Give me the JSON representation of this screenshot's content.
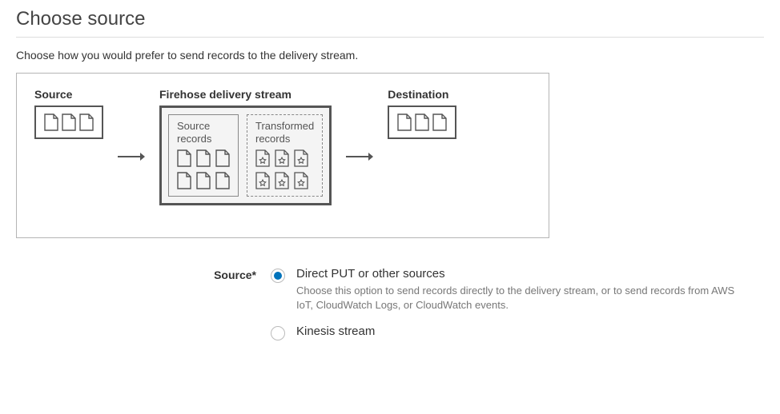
{
  "header": {
    "title": "Choose source"
  },
  "intro": "Choose how you would prefer to send records to the delivery stream.",
  "diagram": {
    "source_label": "Source",
    "firehose_label": "Firehose delivery stream",
    "destination_label": "Destination",
    "source_records_label": "Source records",
    "transformed_records_label": "Transformed records"
  },
  "form": {
    "source_label": "Source*",
    "options": [
      {
        "label": "Direct PUT or other sources",
        "help": "Choose this option to send records directly to the delivery stream, or to send records from AWS IoT, CloudWatch Logs, or CloudWatch events.",
        "selected": true
      },
      {
        "label": "Kinesis stream",
        "help": "",
        "selected": false
      }
    ]
  }
}
